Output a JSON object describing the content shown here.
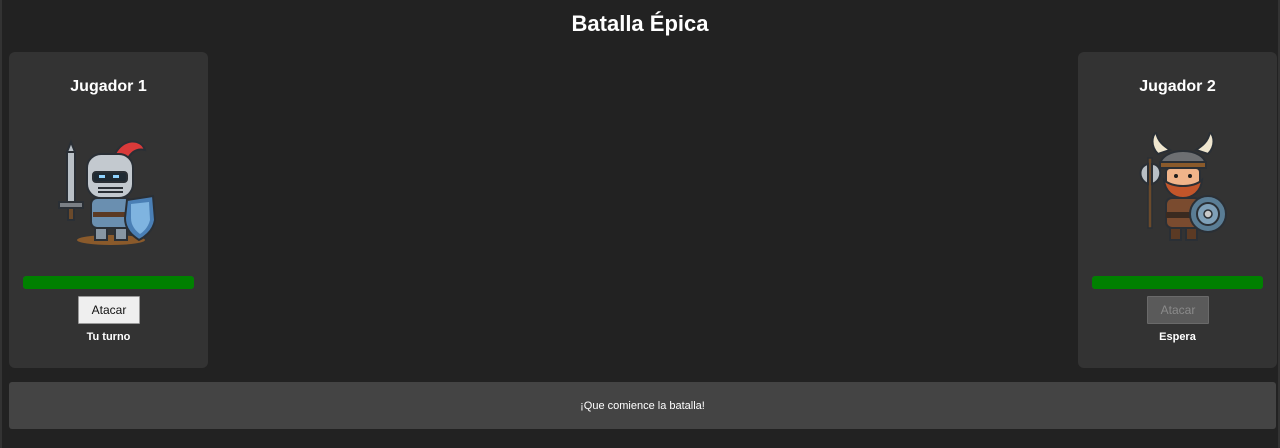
{
  "header": {
    "title": "Batalla Épica"
  },
  "players": [
    {
      "name": "Jugador 1",
      "avatar_icon": "knight-icon",
      "health": 1.0,
      "health_color": "#008000",
      "attack_label": "Atacar",
      "attack_enabled": true,
      "status": "Tu turno"
    },
    {
      "name": "Jugador 2",
      "avatar_icon": "viking-icon",
      "health": 1.0,
      "health_color": "#008000",
      "attack_label": "Atacar",
      "attack_enabled": false,
      "status": "Espera"
    }
  ],
  "log": {
    "message": "¡Que comience la batalla!"
  }
}
